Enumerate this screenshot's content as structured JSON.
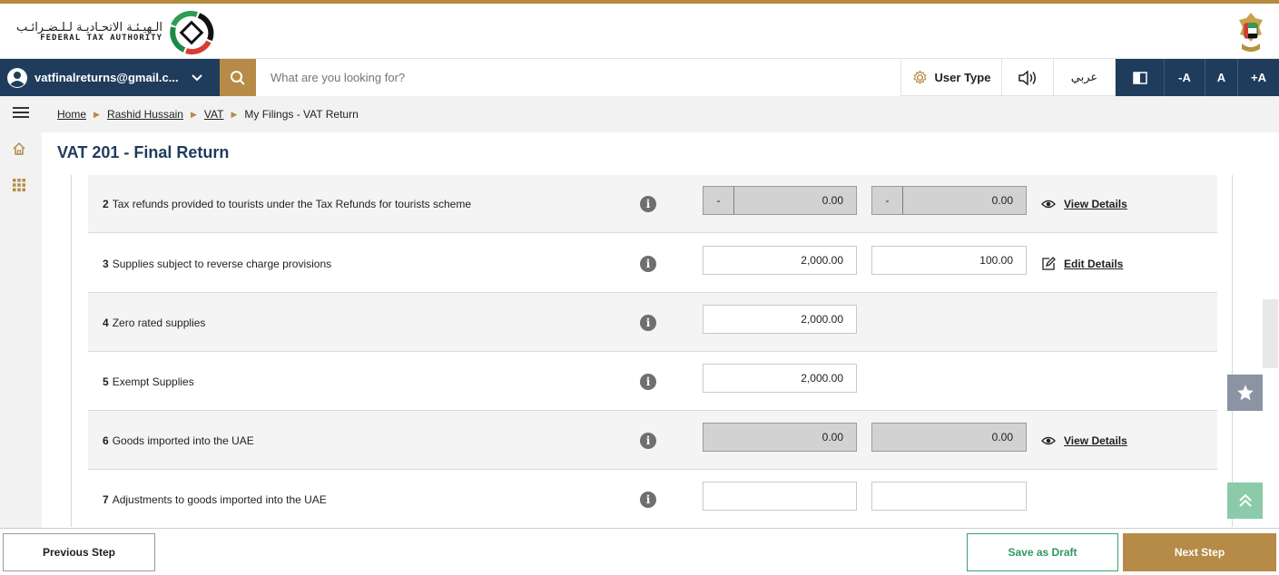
{
  "header": {
    "logo_arabic": "الـهيـئـة الاتحـاديـة لـلـضـرائـب",
    "logo_english": "FEDERAL TAX AUTHORITY"
  },
  "navbar": {
    "account_email": "vatfinalreturns@gmail.c...",
    "search_placeholder": "What are you looking for?",
    "user_type_label": "User Type",
    "arabic_label": "عربي",
    "font_decrease": "-A",
    "font_normal": "A",
    "font_increase": "+A"
  },
  "breadcrumb": {
    "items": [
      "Home",
      "Rashid Hussain",
      "VAT",
      "My Filings - VAT Return"
    ]
  },
  "page": {
    "title": "VAT 201 - Final Return"
  },
  "rows": [
    {
      "number": "2",
      "label": "Tax refunds provided to tourists under the Tax Refunds for tourists scheme",
      "amount": "0.00",
      "vat": "0.00",
      "sign_amount": "-",
      "sign_vat": "-",
      "action": "View Details"
    },
    {
      "number": "3",
      "label": "Supplies subject to reverse charge provisions",
      "amount": "2,000.00",
      "vat": "100.00",
      "action": "Edit Details"
    },
    {
      "number": "4",
      "label": "Zero rated supplies",
      "amount": "2,000.00"
    },
    {
      "number": "5",
      "label": "Exempt Supplies",
      "amount": "2,000.00"
    },
    {
      "number": "6",
      "label": "Goods imported into the UAE",
      "amount": "0.00",
      "vat": "0.00",
      "action": "View Details"
    },
    {
      "number": "7",
      "label": "Adjustments to goods imported into the UAE",
      "amount": "",
      "vat": ""
    }
  ],
  "footer": {
    "previous_label": "Previous Step",
    "draft_label": "Save as Draft",
    "next_label": "Next Step"
  },
  "colors": {
    "navy": "#1f3c5c",
    "gold": "#b58b47",
    "green": "#2f9665"
  }
}
